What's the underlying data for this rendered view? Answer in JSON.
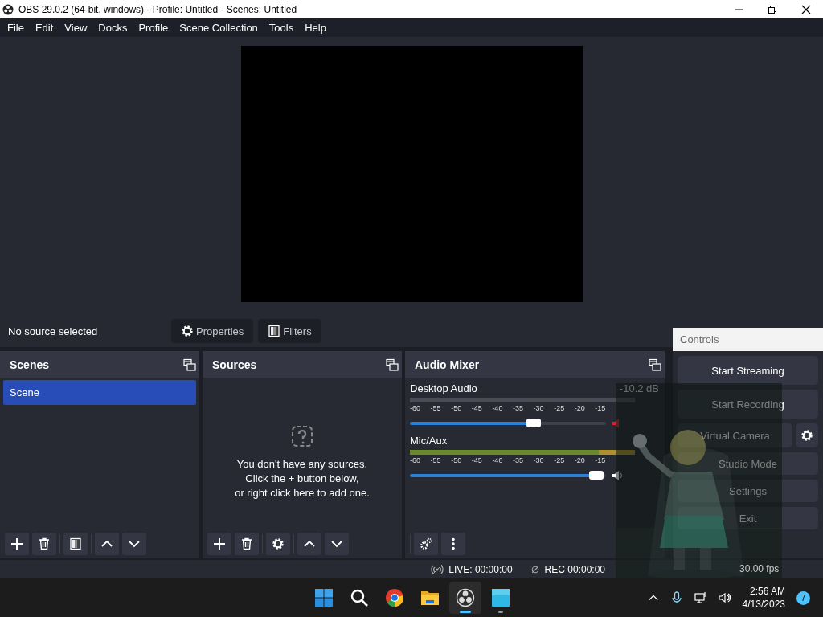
{
  "window": {
    "title": "OBS 29.0.2 (64-bit, windows) - Profile: Untitled - Scenes: Untitled"
  },
  "menu": [
    "File",
    "Edit",
    "View",
    "Docks",
    "Profile",
    "Scene Collection",
    "Tools",
    "Help"
  ],
  "context_bar": {
    "label": "No source selected",
    "buttons": [
      {
        "label": "Properties",
        "kind": "gear"
      },
      {
        "label": "Filters",
        "kind": "filter"
      }
    ]
  },
  "scenes": {
    "title": "Scenes",
    "items": [
      {
        "label": "Scene",
        "selected": true
      }
    ],
    "toolbar": [
      {
        "kind": "plus"
      },
      {
        "kind": "trash"
      },
      {
        "kind": "filter"
      },
      {
        "kind": "up"
      },
      {
        "kind": "down"
      }
    ]
  },
  "sources": {
    "title": "Sources",
    "empty_text": "You don't have any sources.\nClick the + button below,\nor right click here to add one.",
    "toolbar": [
      {
        "kind": "plus"
      },
      {
        "kind": "trash"
      },
      {
        "kind": "gear"
      },
      {
        "kind": "up"
      },
      {
        "kind": "down"
      }
    ]
  },
  "audio_mixer": {
    "title": "Audio Mixer",
    "channels": [
      {
        "name": "Desktop Audio",
        "reading": "-10.2 dB",
        "signal": false,
        "muted": true,
        "level": 0.63,
        "ticks": [
          "-60",
          "-55",
          "-50",
          "-45",
          "-40",
          "-35",
          "-30",
          "-25",
          "-20",
          "-15"
        ]
      },
      {
        "name": "Mic/Aux",
        "signal": true,
        "muted": false,
        "level": 0.95,
        "ticks": [
          "-60",
          "-55",
          "-50",
          "-45",
          "-40",
          "-35",
          "-30",
          "-25",
          "-20",
          "-15"
        ]
      }
    ],
    "toolbar": [
      {
        "kind": "gears"
      },
      {
        "kind": "dots"
      }
    ]
  },
  "controls": {
    "title": "Controls",
    "buttons": [
      {
        "label": "Start Streaming",
        "kind": "plain"
      },
      {
        "label": "Start Recording",
        "kind": "plain"
      },
      {
        "label": "Virtual Camera",
        "kind": "split"
      },
      {
        "label": "Studio Mode",
        "kind": "plain"
      },
      {
        "label": "Settings",
        "kind": "plain"
      },
      {
        "label": "Exit",
        "kind": "plain"
      }
    ]
  },
  "status_bar": {
    "live": "LIVE: 00:00:00",
    "rec": "REC 00:00:00",
    "fps": "30.00 fps"
  },
  "taskbar": {
    "apps": [
      {
        "kind": "start",
        "active": false,
        "running": false
      },
      {
        "kind": "search",
        "active": false,
        "running": false
      },
      {
        "kind": "browser",
        "active": false,
        "running": false
      },
      {
        "kind": "folder",
        "active": false,
        "running": false
      },
      {
        "kind": "obs",
        "active": true,
        "running": true
      },
      {
        "kind": "app",
        "active": false,
        "running": true
      }
    ],
    "time": "2:56 AM",
    "date": "4/13/2023",
    "notifications": "7"
  }
}
